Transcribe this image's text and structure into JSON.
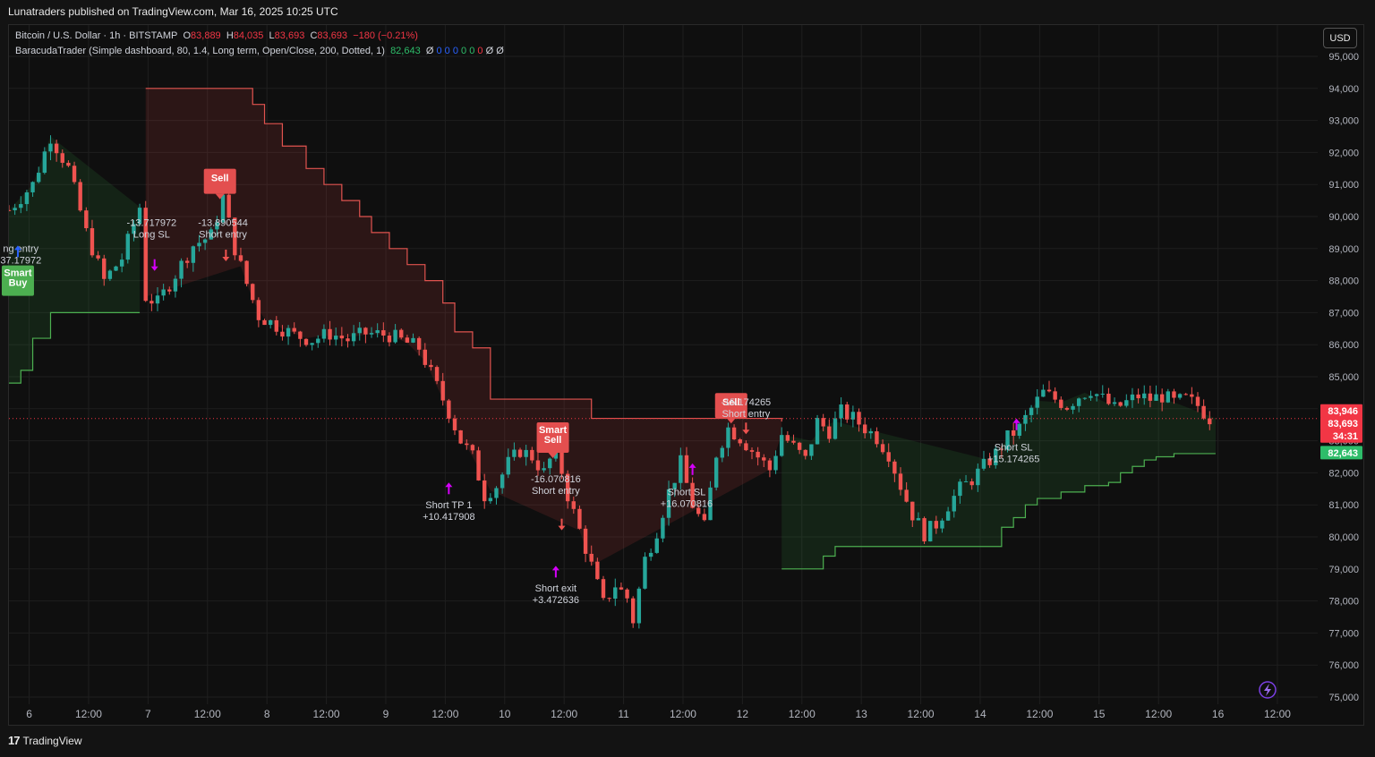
{
  "header": {
    "publisher_text": "Lunatraders published on TradingView.com, Mar 16, 2025 10:25 UTC"
  },
  "legend": {
    "symbol": "Bitcoin / U.S. Dollar · 1h · BITSTAMP",
    "o_label": "O",
    "o_value": "83,889",
    "h_label": "H",
    "h_value": "84,035",
    "l_label": "L",
    "l_value": "83,693",
    "c_label": "C",
    "c_value": "83,693",
    "change": "−180 (−0.21%)",
    "indicator": "BaracudaTrader (Simple dashboard, 80, 1.4, Long term, Open/Close, 200, Dotted, 1)",
    "indicator_value": "82,643",
    "indicator_flags": [
      "Ø",
      "0",
      "0",
      "0",
      "0",
      "0",
      "0",
      "Ø",
      "Ø"
    ]
  },
  "currency_button": "USD",
  "footer": {
    "brand": "TradingView",
    "logo": "17"
  },
  "colors": {
    "background": "#0f0f0f",
    "up": "#26a69a",
    "down": "#ef5350",
    "red_label": "#e34f4f",
    "green_label": "#4caf50",
    "magenta": "#d500f9"
  },
  "icons": [
    "tradingview-logo-icon",
    "lightning-icon"
  ],
  "chart_data": {
    "type": "candlestick",
    "symbol": "Bitcoin / U.S. Dollar",
    "interval": "1h",
    "y_ticks": [
      "95,000",
      "94,000",
      "93,000",
      "92,000",
      "91,000",
      "90,000",
      "89,000",
      "88,000",
      "87,000",
      "86,000",
      "85,000",
      "84,000",
      "83,000",
      "82,000",
      "81,000",
      "80,000",
      "79,000",
      "78,000",
      "77,000",
      "76,000",
      "75,000"
    ],
    "x_ticks": [
      "6",
      "12:00",
      "7",
      "12:00",
      "8",
      "12:00",
      "9",
      "12:00",
      "10",
      "12:00",
      "11",
      "12:00",
      "12",
      "12:00",
      "13",
      "12:00",
      "14",
      "12:00",
      "15",
      "12:00",
      "16",
      "12:00"
    ],
    "ylim": [
      75000,
      95000
    ],
    "price_badges": [
      {
        "text": "83,946",
        "value": 83946,
        "color": "#f23645"
      },
      {
        "text": "83,693",
        "value": 83693,
        "color": "#f23645"
      },
      {
        "text": "34:31",
        "value": 83450,
        "color": "#f23645"
      },
      {
        "text": "82,643",
        "value": 82643,
        "color": "#2ebd6a"
      }
    ],
    "last_price": 83693,
    "price_path": [
      [
        0,
        90200
      ],
      [
        4,
        91000
      ],
      [
        7,
        92500
      ],
      [
        10,
        91500
      ],
      [
        13,
        89500
      ],
      [
        16,
        88000
      ],
      [
        19,
        88700
      ],
      [
        22,
        90300
      ],
      [
        23,
        87500
      ],
      [
        25,
        87300
      ],
      [
        28,
        88200
      ],
      [
        31,
        89100
      ],
      [
        34,
        89400
      ],
      [
        36,
        90600
      ],
      [
        38,
        89000
      ],
      [
        40,
        87900
      ],
      [
        42,
        86900
      ],
      [
        45,
        86600
      ],
      [
        48,
        86300
      ],
      [
        51,
        86150
      ],
      [
        54,
        86350
      ],
      [
        57,
        86150
      ],
      [
        60,
        86350
      ],
      [
        64,
        86300
      ],
      [
        67,
        86050
      ],
      [
        69,
        85900
      ],
      [
        71,
        85100
      ],
      [
        74,
        83900
      ],
      [
        76,
        83000
      ],
      [
        78,
        82500
      ],
      [
        80,
        81300
      ],
      [
        82,
        81600
      ],
      [
        84,
        82300
      ],
      [
        86,
        82700
      ],
      [
        88,
        82500
      ],
      [
        90,
        82000
      ],
      [
        92,
        82800
      ],
      [
        94,
        81300
      ],
      [
        96,
        80200
      ],
      [
        98,
        79100
      ],
      [
        100,
        77900
      ],
      [
        102,
        78500
      ],
      [
        104,
        78100
      ],
      [
        105,
        77400
      ],
      [
        107,
        79300
      ],
      [
        109,
        80200
      ],
      [
        111,
        81400
      ],
      [
        113,
        82300
      ],
      [
        115,
        81000
      ],
      [
        117,
        80300
      ],
      [
        119,
        82600
      ],
      [
        121,
        83400
      ],
      [
        123,
        83100
      ],
      [
        125,
        82700
      ],
      [
        127,
        82300
      ],
      [
        128,
        82100
      ],
      [
        130,
        83200
      ],
      [
        132,
        82800
      ],
      [
        134,
        82400
      ],
      [
        136,
        83600
      ],
      [
        138,
        83300
      ],
      [
        140,
        83900
      ],
      [
        142,
        83700
      ],
      [
        144,
        83400
      ],
      [
        146,
        83100
      ],
      [
        148,
        82600
      ],
      [
        150,
        81600
      ],
      [
        152,
        80700
      ],
      [
        154,
        80100
      ],
      [
        156,
        80400
      ],
      [
        158,
        81000
      ],
      [
        160,
        81500
      ],
      [
        162,
        81800
      ],
      [
        164,
        82200
      ],
      [
        166,
        82600
      ],
      [
        168,
        83100
      ],
      [
        170,
        83400
      ],
      [
        172,
        84000
      ],
      [
        174,
        84500
      ],
      [
        176,
        84300
      ],
      [
        178,
        84100
      ],
      [
        180,
        84400
      ],
      [
        182,
        84600
      ],
      [
        184,
        84300
      ],
      [
        186,
        84000
      ],
      [
        188,
        84200
      ],
      [
        190,
        84400
      ],
      [
        192,
        84300
      ],
      [
        194,
        84400
      ],
      [
        196,
        84200
      ],
      [
        198,
        84300
      ],
      [
        200,
        84100
      ],
      [
        202,
        83700
      ]
    ],
    "resistance_band": [
      [
        23,
        94000
      ],
      [
        39,
        94000
      ],
      [
        41,
        93500
      ],
      [
        43,
        92900
      ],
      [
        46,
        92200
      ],
      [
        50,
        91500
      ],
      [
        53,
        91000
      ],
      [
        56,
        90500
      ],
      [
        59,
        90000
      ],
      [
        61,
        89500
      ],
      [
        64,
        89000
      ],
      [
        67,
        88500
      ],
      [
        70,
        88000
      ],
      [
        73,
        87300
      ],
      [
        75,
        86400
      ],
      [
        78,
        85900
      ],
      [
        81,
        84300
      ],
      [
        96,
        84300
      ],
      [
        98,
        83700
      ],
      [
        128,
        83700
      ],
      [
        130,
        83600
      ]
    ],
    "support_band_left": [
      [
        0,
        84800
      ],
      [
        2,
        85200
      ],
      [
        4,
        86200
      ],
      [
        7,
        87000
      ],
      [
        22,
        87000
      ]
    ],
    "support_band_right": [
      [
        130,
        79000
      ],
      [
        135,
        79000
      ],
      [
        137,
        79400
      ],
      [
        139,
        79700
      ],
      [
        165,
        79700
      ],
      [
        167,
        80300
      ],
      [
        169,
        80600
      ],
      [
        171,
        81000
      ],
      [
        173,
        81200
      ],
      [
        177,
        81400
      ],
      [
        181,
        81600
      ],
      [
        185,
        81700
      ],
      [
        187,
        82000
      ],
      [
        189,
        82200
      ],
      [
        191,
        82400
      ],
      [
        193,
        82500
      ],
      [
        196,
        82600
      ],
      [
        203,
        82600
      ]
    ],
    "signals": [
      {
        "label": "Smart\nBuy",
        "t": 1.5,
        "price": 88000,
        "kind": "buy-box"
      },
      {
        "label": "Sell",
        "t": 35.5,
        "price": 91100,
        "kind": "sell-box"
      },
      {
        "label": "Smart\nSell",
        "t": 91.5,
        "price": 83100,
        "kind": "sell-box"
      },
      {
        "label": "Sell",
        "t": 121.5,
        "price": 84100,
        "kind": "sell-box"
      }
    ],
    "annotations": [
      {
        "lines": [
          "ng entry",
          "37.17972"
        ],
        "t": 2,
        "price": 88900
      },
      {
        "lines": [
          "-13.717972",
          "Long SL"
        ],
        "t": 24,
        "price": 89700
      },
      {
        "lines": [
          "-13.890544",
          "Short entry"
        ],
        "t": 36,
        "price": 89700
      },
      {
        "lines": [
          "Short TP 1",
          "+10.417908"
        ],
        "t": 74,
        "price": 80900
      },
      {
        "lines": [
          "-16.070816",
          "Short entry"
        ],
        "t": 92,
        "price": 81700
      },
      {
        "lines": [
          "Short exit",
          "+3.472636"
        ],
        "t": 92,
        "price": 78300
      },
      {
        "lines": [
          "Short SL",
          "+16.070816"
        ],
        "t": 114,
        "price": 81300
      },
      {
        "lines": [
          "-15.174265",
          "Short entry"
        ],
        "t": 124,
        "price": 84100
      },
      {
        "lines": [
          "Short SL",
          "+15.174265"
        ],
        "t": 169,
        "price": 82700
      }
    ],
    "markers": [
      {
        "kind": "up-arrow",
        "t": 1.5,
        "price": 88900,
        "color": "#2962ff"
      },
      {
        "kind": "down-arrow",
        "t": 24.5,
        "price": 88500,
        "color": "#d500f9"
      },
      {
        "kind": "down-arrow",
        "t": 36.5,
        "price": 88800,
        "color": "#ef5350"
      },
      {
        "kind": "up-arrow",
        "t": 74,
        "price": 81500,
        "color": "#d500f9"
      },
      {
        "kind": "down-arrow",
        "t": 93,
        "price": 80400,
        "color": "#ef5350"
      },
      {
        "kind": "up-arrow",
        "t": 92,
        "price": 78900,
        "color": "#d500f9"
      },
      {
        "kind": "up-arrow",
        "t": 115,
        "price": 82100,
        "color": "#d500f9"
      },
      {
        "kind": "down-arrow",
        "t": 124,
        "price": 83400,
        "color": "#ef5350"
      },
      {
        "kind": "up-arrow",
        "t": 169.5,
        "price": 83500,
        "color": "#d500f9"
      }
    ]
  }
}
